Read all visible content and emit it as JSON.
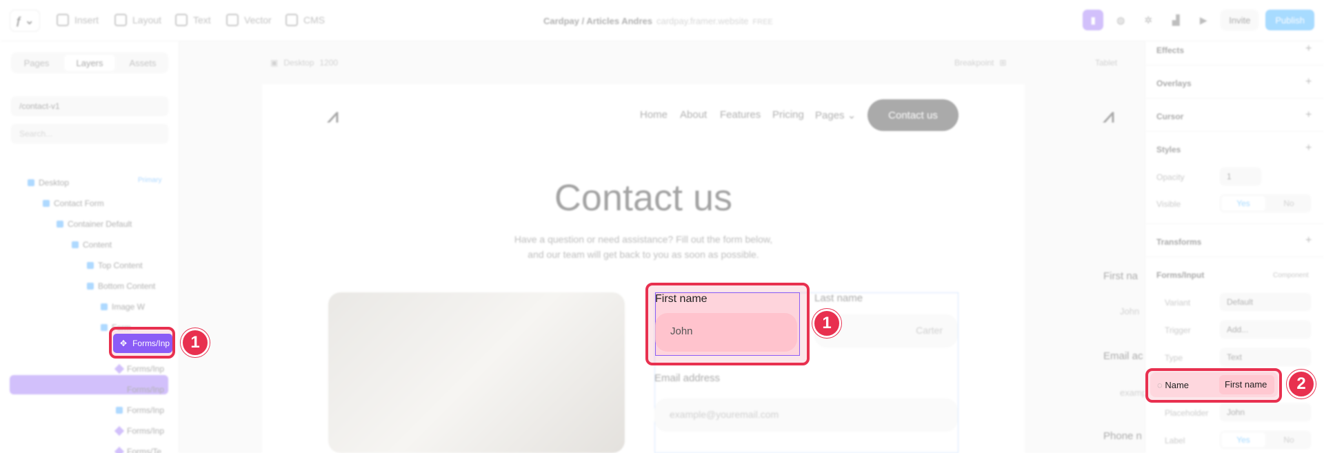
{
  "toolbar": {
    "logo": "ƒ ⌄",
    "tools": [
      "Insert",
      "Layout",
      "Text",
      "Vector",
      "CMS"
    ],
    "project_title": "Cardpay / Articles Andres",
    "project_site": "cardpay.framer.website",
    "project_plan": "FREE",
    "invite_label": "Invite",
    "publish_label": "Publish",
    "accent_color": "#1aa1ff"
  },
  "left_panel": {
    "tabs": [
      "Pages",
      "Layers",
      "Assets"
    ],
    "active_tab": "Layers",
    "page_select": "/contact-v1",
    "search_placeholder": "Search...",
    "layers": [
      {
        "label": "Desktop",
        "tag": "Primary"
      },
      {
        "label": "Contact Form"
      },
      {
        "label": "Container Default"
      },
      {
        "label": "Content"
      },
      {
        "label": "Top Content"
      },
      {
        "label": "Bottom Content"
      },
      {
        "label": "Image W"
      },
      {
        "label": "Form"
      },
      {
        "label": "Forms/Inp"
      },
      {
        "label": "Forms/Inp"
      },
      {
        "label": "Forms/Inp"
      },
      {
        "label": "Forms/Inp"
      },
      {
        "label": "Forms/Inp"
      },
      {
        "label": "Forms/Te"
      }
    ]
  },
  "canvas": {
    "desktop_label": "Desktop",
    "desktop_width": "1200",
    "breakpoint_label": "Breakpoint",
    "tablet_label": "Tablet",
    "site": {
      "logo": "⩘",
      "nav": [
        "Home",
        "About",
        "Features",
        "Pricing",
        "Pages ⌄"
      ],
      "cta": "Contact us",
      "title": "Contact us",
      "subtitle_1": "Have a question or need assistance? Fill out the form below,",
      "subtitle_2": "and our team will get back to you as soon as possible.",
      "first_name_label": "First name",
      "first_name_placeholder": "John",
      "last_name_label": "Last name",
      "last_name_placeholder": "Carter",
      "email_label": "Email address",
      "email_placeholder": "example@youremail.com"
    },
    "tablet": {
      "first_name": "First na",
      "first_placeholder": "John",
      "email": "Email ac",
      "email_placeholder": "examp",
      "phone": "Phone n"
    }
  },
  "right_panel": {
    "sections": [
      "Effects",
      "Overlays",
      "Cursor",
      "Styles",
      "Transforms"
    ],
    "opacity_label": "Opacity",
    "opacity_value": "1",
    "visible_label": "Visible",
    "yes": "Yes",
    "no": "No",
    "component_title": "Forms/Input",
    "component_tag": "Component",
    "variant_label": "Variant",
    "variant_value": "Default",
    "trigger_label": "Trigger",
    "trigger_value": "Add...",
    "type_label": "Type",
    "type_value": "Text",
    "name_label": "Name",
    "name_value": "First name",
    "placeholder_label": "Placeholder",
    "placeholder_value": "John",
    "label_label": "Label"
  },
  "annotations": {
    "badge_1": "1",
    "badge_2": "2",
    "highlight_color": "#e8304f"
  }
}
